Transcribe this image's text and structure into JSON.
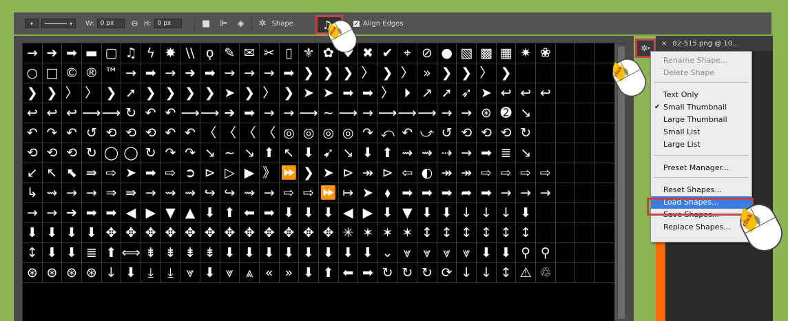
{
  "toolbar": {
    "w_label": "W:",
    "w_value": "0 px",
    "link_icon": "link-icon",
    "h_label": "H:",
    "h_value": "0 px",
    "shape_label": "Shape",
    "align_edges_label": "Align Edges",
    "align_edges_checked": true
  },
  "doc_tab": {
    "close": "×",
    "title": "82-515.png @ 10..."
  },
  "menu": {
    "items": [
      {
        "label": "Rename Shape...",
        "disabled": true,
        "checked": false
      },
      {
        "label": "Delete Shape",
        "disabled": true,
        "checked": false
      },
      {
        "label": "Text Only",
        "disabled": false,
        "checked": false
      },
      {
        "label": "Small Thumbnail",
        "disabled": false,
        "checked": true
      },
      {
        "label": "Large Thumbnail",
        "disabled": false,
        "checked": false
      },
      {
        "label": "Small List",
        "disabled": false,
        "checked": false
      },
      {
        "label": "Large List",
        "disabled": false,
        "checked": false
      },
      {
        "label": "Preset Manager...",
        "disabled": false,
        "checked": false
      },
      {
        "label": "Reset Shapes...",
        "disabled": false,
        "checked": false
      },
      {
        "label": "Load Shapes...",
        "disabled": false,
        "checked": false,
        "highlighted": true
      },
      {
        "label": "Save Shapes...",
        "disabled": false,
        "checked": false
      },
      {
        "label": "Replace Shapes...",
        "disabled": false,
        "checked": false
      }
    ]
  },
  "mouse_labels": {
    "label": "click"
  },
  "shape_grid": [
    "→",
    "➔",
    "➡",
    "▬",
    "▢",
    "♫",
    "ϟ",
    "✸",
    "\\\\",
    "ϙ",
    "✎",
    "✉",
    "✂",
    "▯",
    "⚜",
    "✿",
    "♥",
    "✖",
    "✔",
    "⌖",
    "⊘",
    "●",
    "▧",
    "▩",
    "▦",
    "✷",
    "❀",
    " ",
    " ",
    " ",
    "○",
    "□",
    "©",
    "®",
    "™",
    "→",
    "➡",
    "→",
    "➜",
    "➡",
    "→",
    "→",
    "→",
    "➡",
    "❯",
    "❯",
    "❯",
    "〉",
    "❯",
    "〉",
    "»",
    "❯",
    "❯",
    "〉",
    "❯",
    " ",
    " ",
    " ",
    " ",
    " ",
    "❯",
    "❯",
    "〉",
    "〉",
    "❯",
    "➚",
    "❯",
    "❯",
    "❯",
    "❯",
    "➤",
    "❯",
    "〉",
    "❯",
    "➤",
    "➤",
    "➡",
    "➡",
    "〉",
    "⏵",
    "↗",
    "➚",
    "➶",
    "➤",
    "↩",
    "↩",
    "↩",
    " ",
    " ",
    " ",
    "↩",
    "↩",
    "↩",
    "⟶",
    "⟶",
    "↻",
    "↶",
    "↶",
    "⟶",
    "⟶",
    "➔",
    "➡",
    "→",
    "→",
    "⟶",
    "~",
    "⟶",
    "→",
    "⟶",
    "⟶",
    "⟶",
    "→",
    "→",
    "⊛",
    "➋",
    "↘",
    " ",
    " ",
    " ",
    " ",
    "↶",
    "↷",
    "↶",
    "↺",
    "⟲",
    "⟲",
    "⟲",
    "↶",
    "↶",
    "〈",
    "〈",
    "〈",
    "〈",
    "◎",
    "◎",
    "◎",
    "◎",
    "↷",
    "⤺",
    "↶",
    "⤻",
    "↺",
    "⟲",
    "⟲",
    "⟲",
    "↻",
    " ",
    " ",
    " ",
    " ",
    "⟲",
    "⟲",
    "⟲",
    "↻",
    "◯",
    "◯",
    "↻",
    "↷",
    "↷",
    "↘",
    "~",
    "↘",
    "⬆",
    "↖",
    "⬇",
    "➹",
    "↘",
    "⬇",
    "⬆",
    "⇝",
    "⇝",
    "⇢",
    "→",
    "➡",
    "≣",
    "↘",
    " ",
    " ",
    " ",
    " ",
    "↙",
    "↖",
    "⬉",
    "⇛",
    "⇨",
    "➤",
    "➡",
    "⇨",
    "➲",
    "⊳",
    "▷",
    "▶",
    "》",
    "⏩",
    "❯",
    "➤",
    "⊳",
    "↠",
    "⊳",
    "⇦",
    "◐",
    "↠",
    "↠",
    "⇨",
    "⇨",
    "⇨",
    "⇨",
    " ",
    " ",
    " ",
    "↳",
    "⇝",
    "→",
    "→",
    "⇒",
    "⇛",
    "→",
    "⇝",
    "⇝",
    "↪",
    "↪",
    "⇝",
    "→",
    "⇨",
    "⇨",
    "⏩",
    "↦",
    "➤",
    "⬧",
    "➡",
    "➡",
    "➡",
    "➦",
    "➡",
    "→",
    "→",
    "→",
    " ",
    " ",
    " ",
    "→",
    "→",
    "➔",
    "➡",
    "➡",
    "◀",
    "▶",
    "▼",
    "▲",
    "⬇",
    "⬆",
    "⬅",
    "➡",
    "⬇",
    "⬇",
    "⬇",
    "◀",
    "▶",
    "⬇",
    "▼",
    "⬇",
    "⬇",
    "↓",
    "↓",
    "↓",
    "⬇",
    " ",
    " ",
    " ",
    " ",
    "⬇",
    "⬇",
    "⬇",
    "⬇",
    "✥",
    "✥",
    "✥",
    "✥",
    "✥",
    "✥",
    "✥",
    "✥",
    "✥",
    "✥",
    "✥",
    "✥",
    "✳",
    "✶",
    "✶",
    "✶",
    "↕",
    "↕",
    "↕",
    "↕",
    "↕",
    "↕",
    " ",
    " ",
    " ",
    " ",
    "↕",
    "⬇",
    "⬇",
    "≣",
    "⬆",
    "⟺",
    "⇟",
    "⇟",
    "⇟",
    "⇟",
    "⬇",
    "⬇",
    "⬇",
    "⬇",
    "⬇",
    "⬇",
    "⬇",
    "⬇",
    "⌄",
    "⩔",
    "⩔",
    "⩔",
    "⩔",
    "⬇",
    "⬇",
    "⚲",
    "⚲",
    " ",
    " ",
    " ",
    "⊛",
    "⊛",
    "⊛",
    "⊛",
    "↓",
    "⬇",
    "⤓",
    "⤓",
    "⩔",
    "⬇",
    "⩔",
    "⩓",
    "«",
    "»",
    "⬇",
    "⬆",
    "⬅",
    "➡",
    "↻",
    "↻",
    "↻",
    "⟳",
    "↓",
    "↓",
    "↕",
    "⚠",
    "♲",
    " ",
    " ",
    " "
  ]
}
